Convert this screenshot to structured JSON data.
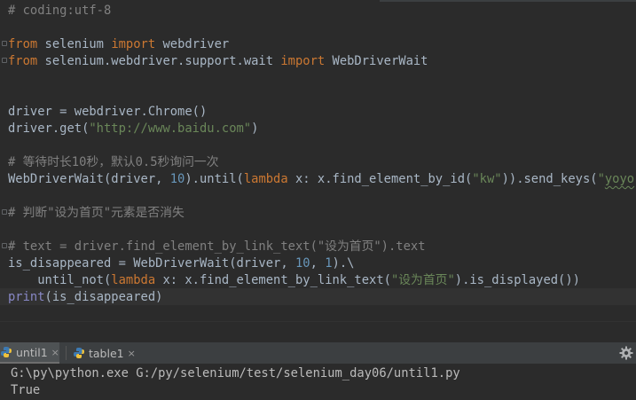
{
  "editor": {
    "lines": [
      {
        "segs": [
          {
            "t": "# coding:utf-8",
            "c": "cm"
          }
        ]
      },
      {
        "segs": []
      },
      {
        "segs": [
          {
            "t": "from",
            "c": "kw"
          },
          {
            "t": " selenium "
          },
          {
            "t": "import",
            "c": "kw"
          },
          {
            "t": " webdriver"
          }
        ]
      },
      {
        "segs": [
          {
            "t": "from",
            "c": "kw"
          },
          {
            "t": " selenium.webdriver.support.wait "
          },
          {
            "t": "import",
            "c": "kw"
          },
          {
            "t": " WebDriverWait"
          }
        ]
      },
      {
        "segs": []
      },
      {
        "segs": []
      },
      {
        "segs": [
          {
            "t": "driver = webdriver.Chrome()"
          }
        ]
      },
      {
        "segs": [
          {
            "t": "driver.get("
          },
          {
            "t": "\"http://www.baidu.com\"",
            "c": "str"
          },
          {
            "t": ")"
          }
        ]
      },
      {
        "segs": []
      },
      {
        "segs": [
          {
            "t": "# 等待时长10秒，默认0.5秒询问一次",
            "c": "cm"
          }
        ]
      },
      {
        "segs": [
          {
            "t": "WebDriverWait(driver, "
          },
          {
            "t": "10",
            "c": "num"
          },
          {
            "t": ").until("
          },
          {
            "t": "lambda",
            "c": "kw"
          },
          {
            "t": " x: x.find_element_by_id("
          },
          {
            "t": "\"kw\"",
            "c": "str"
          },
          {
            "t": ")).send_keys("
          },
          {
            "t": "\"",
            "c": "str"
          },
          {
            "t": "yoyo",
            "c": "str squig"
          },
          {
            "t": "\"",
            "c": "str"
          },
          {
            "t": ")"
          }
        ]
      },
      {
        "segs": []
      },
      {
        "segs": [
          {
            "t": "# 判断\"设为首页\"元素是否消失",
            "c": "cm"
          }
        ]
      },
      {
        "segs": []
      },
      {
        "segs": [
          {
            "t": "# text = driver.find_element_by_link_text(\"设为首页\").text",
            "c": "cm"
          }
        ]
      },
      {
        "segs": [
          {
            "t": "is_disappeared = WebDriverWait(driver, "
          },
          {
            "t": "10",
            "c": "num"
          },
          {
            "t": ", "
          },
          {
            "t": "1",
            "c": "num"
          },
          {
            "t": ").\\"
          }
        ]
      },
      {
        "segs": [
          {
            "t": "    until_not("
          },
          {
            "t": "lambda",
            "c": "kw"
          },
          {
            "t": " x: x.find_element_by_link_text("
          },
          {
            "t": "\"设为首页\"",
            "c": "str"
          },
          {
            "t": ").is_displayed())"
          }
        ]
      },
      {
        "segs": [
          {
            "t": "print",
            "c": "fn"
          },
          {
            "t": "(is_disappeared)"
          }
        ]
      }
    ]
  },
  "run_tabs": [
    {
      "label": "until1",
      "close": "×",
      "active": true
    },
    {
      "label": "table1",
      "close": "×",
      "active": false
    }
  ],
  "console": {
    "lines": [
      "G:\\py\\python.exe G:/py/selenium/test/selenium_day06/until1.py",
      "True"
    ]
  },
  "colors": {
    "background": "#2b2b2b",
    "keyword": "#cc7832",
    "comment": "#808080",
    "string": "#6a8759",
    "number": "#6897bb",
    "builtin": "#8888c6",
    "text": "#a9b7c6"
  },
  "icons": {
    "tab_icon": "python-icon",
    "settings": "gear-icon"
  }
}
